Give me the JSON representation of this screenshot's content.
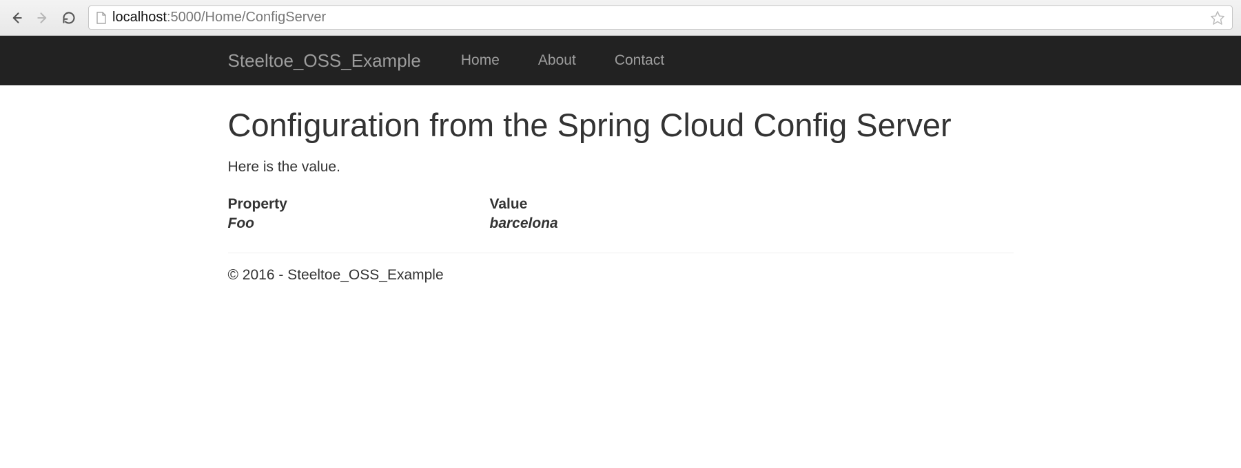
{
  "browser": {
    "url_host": "localhost",
    "url_rest": ":5000/Home/ConfigServer"
  },
  "navbar": {
    "brand": "Steeltoe_OSS_Example",
    "links": [
      {
        "label": "Home"
      },
      {
        "label": "About"
      },
      {
        "label": "Contact"
      }
    ]
  },
  "page": {
    "title": "Configuration from the Spring Cloud Config Server",
    "lead": "Here is the value."
  },
  "config_table": {
    "header_property": "Property",
    "header_value": "Value",
    "rows": [
      {
        "property": "Foo",
        "value": "barcelona"
      }
    ]
  },
  "footer": {
    "text": "© 2016 - Steeltoe_OSS_Example"
  }
}
